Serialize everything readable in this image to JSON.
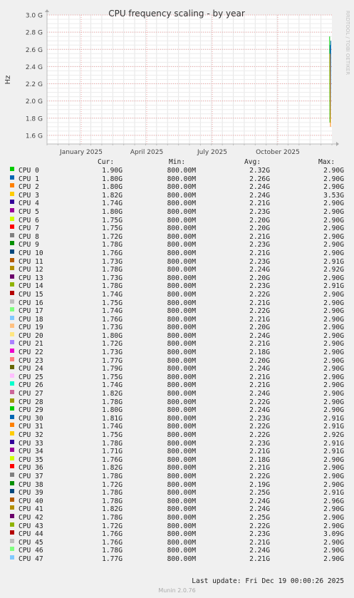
{
  "chart_data": {
    "type": "line",
    "title": "CPU frequency scaling - by year",
    "ylabel": "Hz",
    "watermark": "RRDTOOL / TOBI OETIKER",
    "ylim": [
      1.5,
      3.0
    ],
    "y_ticks": [
      "1.6 G",
      "1.8 G",
      "2.0 G",
      "2.2 G",
      "2.4 G",
      "2.6 G",
      "2.8 G",
      "3.0 G"
    ],
    "y_tick_values": [
      1.6,
      1.8,
      2.0,
      2.2,
      2.4,
      2.6,
      2.8,
      3.0
    ],
    "x_ticks": [
      "January 2025",
      "April 2025",
      "July 2025",
      "October 2025"
    ],
    "x_tick_positions": [
      0.12,
      0.35,
      0.58,
      0.81
    ],
    "xlim": [
      0,
      1
    ],
    "grid": true,
    "series_line": [
      {
        "color": "#00cc00",
        "x": [
          0.992,
          0.993,
          0.994
        ],
        "y": [
          2.75,
          1.75,
          2.6
        ]
      },
      {
        "color": "#0066b3",
        "x": [
          0.994,
          0.995,
          0.996
        ],
        "y": [
          2.65,
          1.8,
          2.7
        ]
      },
      {
        "color": "#ff8000",
        "x": [
          0.993,
          0.995
        ],
        "y": [
          2.55,
          1.7
        ]
      }
    ]
  },
  "legend": {
    "headers": {
      "cur": "Cur:",
      "min": "Min:",
      "avg": "Avg:",
      "max": "Max:"
    },
    "rows": [
      {
        "name": "CPU 0",
        "color": "#00cc00",
        "cur": "1.90G",
        "min": "800.00M",
        "avg": "2.32G",
        "max": "2.90G"
      },
      {
        "name": "CPU 1",
        "color": "#0066b3",
        "cur": "1.80G",
        "min": "800.00M",
        "avg": "2.26G",
        "max": "2.90G"
      },
      {
        "name": "CPU 2",
        "color": "#ff8000",
        "cur": "1.80G",
        "min": "800.00M",
        "avg": "2.24G",
        "max": "2.90G"
      },
      {
        "name": "CPU 3",
        "color": "#ffcc00",
        "cur": "1.82G",
        "min": "800.00M",
        "avg": "2.24G",
        "max": "3.53G"
      },
      {
        "name": "CPU 4",
        "color": "#330099",
        "cur": "1.74G",
        "min": "800.00M",
        "avg": "2.21G",
        "max": "2.90G"
      },
      {
        "name": "CPU 5",
        "color": "#990099",
        "cur": "1.80G",
        "min": "800.00M",
        "avg": "2.23G",
        "max": "2.90G"
      },
      {
        "name": "CPU 6",
        "color": "#ccff00",
        "cur": "1.75G",
        "min": "800.00M",
        "avg": "2.20G",
        "max": "2.90G"
      },
      {
        "name": "CPU 7",
        "color": "#ff0000",
        "cur": "1.75G",
        "min": "800.00M",
        "avg": "2.20G",
        "max": "2.90G"
      },
      {
        "name": "CPU 8",
        "color": "#808080",
        "cur": "1.72G",
        "min": "800.00M",
        "avg": "2.21G",
        "max": "2.90G"
      },
      {
        "name": "CPU 9",
        "color": "#008f00",
        "cur": "1.78G",
        "min": "800.00M",
        "avg": "2.23G",
        "max": "2.90G"
      },
      {
        "name": "CPU 10",
        "color": "#00487d",
        "cur": "1.76G",
        "min": "800.00M",
        "avg": "2.21G",
        "max": "2.90G"
      },
      {
        "name": "CPU 11",
        "color": "#b35a00",
        "cur": "1.73G",
        "min": "800.00M",
        "avg": "2.23G",
        "max": "2.91G"
      },
      {
        "name": "CPU 12",
        "color": "#b38f00",
        "cur": "1.78G",
        "min": "800.00M",
        "avg": "2.24G",
        "max": "2.92G"
      },
      {
        "name": "CPU 13",
        "color": "#6b006b",
        "cur": "1.73G",
        "min": "800.00M",
        "avg": "2.20G",
        "max": "2.90G"
      },
      {
        "name": "CPU 14",
        "color": "#8fb300",
        "cur": "1.78G",
        "min": "800.00M",
        "avg": "2.23G",
        "max": "2.91G"
      },
      {
        "name": "CPU 15",
        "color": "#b30000",
        "cur": "1.74G",
        "min": "800.00M",
        "avg": "2.22G",
        "max": "2.90G"
      },
      {
        "name": "CPU 16",
        "color": "#bebebe",
        "cur": "1.75G",
        "min": "800.00M",
        "avg": "2.21G",
        "max": "2.90G"
      },
      {
        "name": "CPU 17",
        "color": "#80ff80",
        "cur": "1.74G",
        "min": "800.00M",
        "avg": "2.22G",
        "max": "2.90G"
      },
      {
        "name": "CPU 18",
        "color": "#80c9ff",
        "cur": "1.76G",
        "min": "800.00M",
        "avg": "2.21G",
        "max": "2.90G"
      },
      {
        "name": "CPU 19",
        "color": "#ffc080",
        "cur": "1.73G",
        "min": "800.00M",
        "avg": "2.20G",
        "max": "2.90G"
      },
      {
        "name": "CPU 20",
        "color": "#ffe680",
        "cur": "1.80G",
        "min": "800.00M",
        "avg": "2.24G",
        "max": "2.90G"
      },
      {
        "name": "CPU 21",
        "color": "#aa80ff",
        "cur": "1.72G",
        "min": "800.00M",
        "avg": "2.21G",
        "max": "2.90G"
      },
      {
        "name": "CPU 22",
        "color": "#ee00cc",
        "cur": "1.73G",
        "min": "800.00M",
        "avg": "2.18G",
        "max": "2.90G"
      },
      {
        "name": "CPU 23",
        "color": "#ff8080",
        "cur": "1.77G",
        "min": "800.00M",
        "avg": "2.20G",
        "max": "2.90G"
      },
      {
        "name": "CPU 24",
        "color": "#666600",
        "cur": "1.79G",
        "min": "800.00M",
        "avg": "2.24G",
        "max": "2.90G"
      },
      {
        "name": "CPU 25",
        "color": "#ffbfff",
        "cur": "1.75G",
        "min": "800.00M",
        "avg": "2.21G",
        "max": "2.90G"
      },
      {
        "name": "CPU 26",
        "color": "#00ffcc",
        "cur": "1.74G",
        "min": "800.00M",
        "avg": "2.21G",
        "max": "2.90G"
      },
      {
        "name": "CPU 27",
        "color": "#cc6699",
        "cur": "1.82G",
        "min": "800.00M",
        "avg": "2.24G",
        "max": "2.90G"
      },
      {
        "name": "CPU 28",
        "color": "#999900",
        "cur": "1.78G",
        "min": "800.00M",
        "avg": "2.22G",
        "max": "2.90G"
      },
      {
        "name": "CPU 29",
        "color": "#00cc00",
        "cur": "1.80G",
        "min": "800.00M",
        "avg": "2.24G",
        "max": "2.90G"
      },
      {
        "name": "CPU 30",
        "color": "#0066b3",
        "cur": "1.81G",
        "min": "800.00M",
        "avg": "2.23G",
        "max": "2.91G"
      },
      {
        "name": "CPU 31",
        "color": "#ff8000",
        "cur": "1.74G",
        "min": "800.00M",
        "avg": "2.22G",
        "max": "2.91G"
      },
      {
        "name": "CPU 32",
        "color": "#ffcc00",
        "cur": "1.75G",
        "min": "800.00M",
        "avg": "2.22G",
        "max": "2.92G"
      },
      {
        "name": "CPU 33",
        "color": "#330099",
        "cur": "1.78G",
        "min": "800.00M",
        "avg": "2.23G",
        "max": "2.91G"
      },
      {
        "name": "CPU 34",
        "color": "#990099",
        "cur": "1.71G",
        "min": "800.00M",
        "avg": "2.21G",
        "max": "2.91G"
      },
      {
        "name": "CPU 35",
        "color": "#ccff00",
        "cur": "1.76G",
        "min": "800.00M",
        "avg": "2.18G",
        "max": "2.90G"
      },
      {
        "name": "CPU 36",
        "color": "#ff0000",
        "cur": "1.82G",
        "min": "800.00M",
        "avg": "2.21G",
        "max": "2.90G"
      },
      {
        "name": "CPU 37",
        "color": "#808080",
        "cur": "1.78G",
        "min": "800.00M",
        "avg": "2.22G",
        "max": "2.90G"
      },
      {
        "name": "CPU 38",
        "color": "#008f00",
        "cur": "1.72G",
        "min": "800.00M",
        "avg": "2.19G",
        "max": "2.90G"
      },
      {
        "name": "CPU 39",
        "color": "#00487d",
        "cur": "1.78G",
        "min": "800.00M",
        "avg": "2.25G",
        "max": "2.91G"
      },
      {
        "name": "CPU 40",
        "color": "#b35a00",
        "cur": "1.78G",
        "min": "800.00M",
        "avg": "2.24G",
        "max": "2.96G"
      },
      {
        "name": "CPU 41",
        "color": "#b38f00",
        "cur": "1.82G",
        "min": "800.00M",
        "avg": "2.24G",
        "max": "2.90G"
      },
      {
        "name": "CPU 42",
        "color": "#6b006b",
        "cur": "1.78G",
        "min": "800.00M",
        "avg": "2.25G",
        "max": "2.90G"
      },
      {
        "name": "CPU 43",
        "color": "#8fb300",
        "cur": "1.72G",
        "min": "800.00M",
        "avg": "2.22G",
        "max": "2.90G"
      },
      {
        "name": "CPU 44",
        "color": "#b30000",
        "cur": "1.76G",
        "min": "800.00M",
        "avg": "2.23G",
        "max": "3.09G"
      },
      {
        "name": "CPU 45",
        "color": "#bebebe",
        "cur": "1.76G",
        "min": "800.00M",
        "avg": "2.21G",
        "max": "2.90G"
      },
      {
        "name": "CPU 46",
        "color": "#80ff80",
        "cur": "1.78G",
        "min": "800.00M",
        "avg": "2.24G",
        "max": "2.90G"
      },
      {
        "name": "CPU 47",
        "color": "#80c9ff",
        "cur": "1.77G",
        "min": "800.00M",
        "avg": "2.21G",
        "max": "2.90G"
      }
    ]
  },
  "last_update": "Last update: Fri Dec 19 00:00:26 2025",
  "footer": "Munin 2.0.76"
}
